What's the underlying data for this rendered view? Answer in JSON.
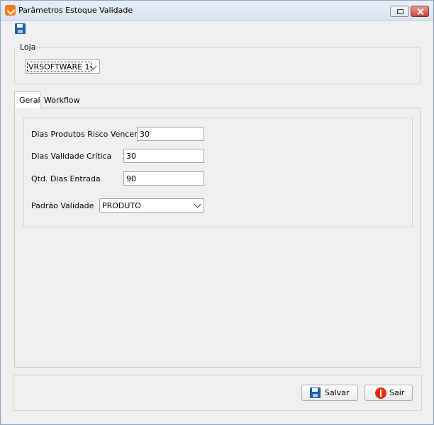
{
  "window": {
    "title": "Parâmetros Estoque Validade"
  },
  "toolbar": {
    "save_icon": "floppy-disk-icon"
  },
  "loja": {
    "label": "Loja",
    "selected": "VRSOFTWARE 1"
  },
  "tabs": [
    {
      "label": "Geral",
      "active": true
    },
    {
      "label": "Workflow",
      "active": false
    }
  ],
  "geral": {
    "dias_risco_label": "Dias Produtos Risco Vencer",
    "dias_risco_value": "30",
    "dias_critica_label": "Dias Validade Crítica",
    "dias_critica_value": "30",
    "qtd_entrada_label": "Qtd. Dias Entrada",
    "qtd_entrada_value": "90",
    "padrao_label": "Padrão Validade",
    "padrao_value": "PRODUTO"
  },
  "buttons": {
    "salvar": "Salvar",
    "sair": "Sair"
  },
  "colors": {
    "accent": "#1d5fa8",
    "exit": "#e02f14",
    "app_icon": "#f07a1a"
  }
}
